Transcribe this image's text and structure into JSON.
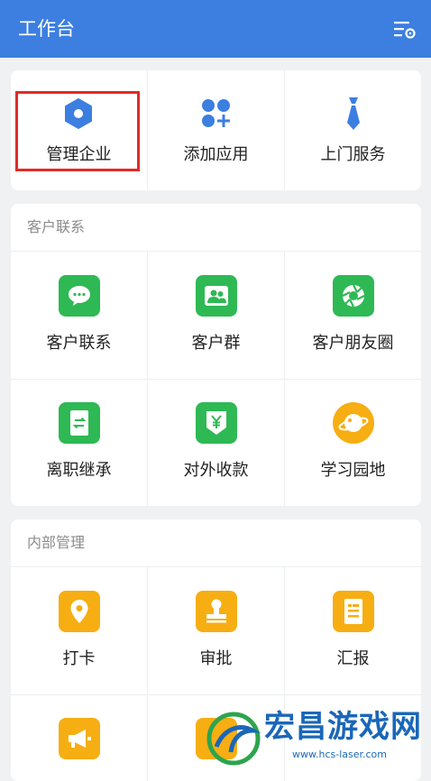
{
  "header": {
    "title": "工作台"
  },
  "top_card": {
    "items": [
      {
        "label": "管理企业",
        "icon": "hexagon-icon"
      },
      {
        "label": "添加应用",
        "icon": "apps-plus-icon"
      },
      {
        "label": "上门服务",
        "icon": "tie-icon"
      }
    ]
  },
  "customer": {
    "title": "客户联系",
    "items": [
      {
        "label": "客户联系",
        "icon": "chat-bubble-icon"
      },
      {
        "label": "客户群",
        "icon": "group-icon"
      },
      {
        "label": "客户朋友圈",
        "icon": "moments-icon"
      },
      {
        "label": "离职继承",
        "icon": "transfer-icon"
      },
      {
        "label": "对外收款",
        "icon": "yuan-shield-icon"
      },
      {
        "label": "学习园地",
        "icon": "planet-icon"
      }
    ]
  },
  "internal": {
    "title": "内部管理",
    "items": [
      {
        "label": "打卡",
        "icon": "location-pin-icon"
      },
      {
        "label": "审批",
        "icon": "stamp-icon"
      },
      {
        "label": "汇报",
        "icon": "report-icon"
      },
      {
        "label": "",
        "icon": "megaphone-icon"
      }
    ]
  },
  "watermark": {
    "brand": "宏昌游戏网",
    "url": "www.hcs-laser.com"
  },
  "colors": {
    "header": "#3c7fe0",
    "accent_blue": "#3c7fe0",
    "green": "#2eb954",
    "orange": "#f6ae13",
    "highlight": "#e02b27"
  }
}
